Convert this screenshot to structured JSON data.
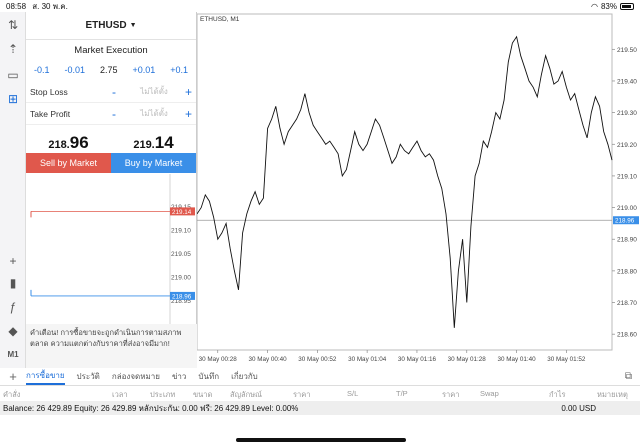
{
  "status": {
    "time": "08:58",
    "date": "ส. 30 พ.ค.",
    "battery": "83%"
  },
  "panel": {
    "symbol": "ETHUSD",
    "mode": "Market Execution",
    "steps": [
      "-0.1",
      "-0.01",
      "2.75",
      "+0.01",
      "+0.1"
    ],
    "stop_loss": {
      "label": "Stop Loss",
      "value": "ไม่ได้ตั้ง"
    },
    "take_profit": {
      "label": "Take Profit",
      "value": "ไม่ได้ตั้ง"
    },
    "bid": {
      "prefix": "218.",
      "big": "96"
    },
    "ask": {
      "prefix": "219.",
      "big": "14"
    },
    "sell_label": "Sell by Market",
    "buy_label": "Buy by Market",
    "warning": "คำเตือน! การซื้อขายจะถูกดำเนินการตามสภาพตลาด ความแตกต่างกับราคาที่ส่งอาจมีมาก!"
  },
  "depth": {
    "ticks": [
      219.15,
      219.1,
      219.05,
      219.0,
      218.95
    ],
    "ask": 219.14,
    "bid": 218.96,
    "ask_label": "219.14",
    "bid_label": "218.96",
    "ask_color": "#e0584c",
    "bid_color": "#3a8fe8"
  },
  "chart_data": {
    "type": "line",
    "title": "ETHUSD, M1",
    "ylim": [
      218.55,
      219.58
    ],
    "y_ticks": [
      219.5,
      219.4,
      219.3,
      219.2,
      219.1,
      219.0,
      218.9,
      218.8,
      218.7,
      218.6
    ],
    "x_tick_labels": [
      "30 May 00:28",
      "30 May 00:40",
      "30 May 00:52",
      "30 May 01:04",
      "30 May 01:16",
      "30 May 01:28",
      "30 May 01:40",
      "30 May 01:52"
    ],
    "x_tick_positions": [
      5,
      17,
      29,
      41,
      53,
      65,
      77,
      89
    ],
    "current_price": 218.96,
    "current_price_label": "218.96",
    "series": [
      {
        "x": [
          0,
          1,
          2,
          3,
          4,
          5,
          6,
          7,
          8,
          9,
          10,
          11,
          12,
          13,
          14,
          15,
          16,
          17,
          18,
          19,
          20,
          21,
          22,
          23,
          24,
          25,
          26,
          27,
          28,
          29,
          30,
          31,
          32,
          33,
          34,
          35,
          36,
          37,
          38,
          39,
          40,
          41,
          42,
          43,
          44,
          45,
          46,
          47,
          48,
          49,
          50,
          51,
          52,
          53,
          54,
          55,
          56,
          57,
          58,
          59,
          60,
          61,
          62,
          63,
          64,
          65,
          66,
          67,
          68,
          69,
          70,
          71,
          72,
          73,
          74,
          75,
          76,
          77,
          78,
          79,
          80,
          81,
          82,
          83,
          84,
          85,
          86,
          87,
          88,
          89,
          90,
          91,
          92,
          93,
          94,
          95,
          96,
          97,
          98,
          99,
          100
        ],
        "values": [
          218.98,
          219.0,
          219.04,
          219.02,
          218.97,
          218.9,
          218.92,
          218.95,
          218.87,
          218.8,
          218.74,
          218.92,
          218.98,
          219.02,
          219.05,
          219.01,
          219.03,
          219.25,
          219.28,
          219.32,
          219.25,
          219.2,
          219.24,
          219.26,
          219.28,
          219.31,
          219.36,
          219.3,
          219.26,
          219.24,
          219.22,
          219.2,
          219.21,
          219.19,
          219.17,
          219.1,
          219.12,
          219.18,
          219.24,
          219.2,
          219.18,
          219.2,
          219.24,
          219.28,
          219.26,
          219.22,
          219.18,
          219.14,
          219.16,
          219.2,
          219.18,
          219.17,
          219.19,
          219.21,
          219.18,
          219.16,
          219.17,
          219.15,
          219.1,
          219.06,
          218.98,
          218.84,
          218.62,
          218.8,
          218.9,
          218.7,
          218.94,
          219.1,
          219.14,
          219.21,
          219.19,
          219.24,
          219.3,
          219.28,
          219.34,
          219.46,
          219.52,
          219.54,
          219.48,
          219.44,
          219.4,
          219.38,
          219.35,
          219.42,
          219.48,
          219.44,
          219.39,
          219.4,
          219.43,
          219.38,
          219.34,
          219.36,
          219.31,
          219.26,
          219.22,
          219.3,
          219.35,
          219.32,
          219.24,
          219.2,
          219.15
        ]
      }
    ]
  },
  "tabs": {
    "add": "+",
    "items": [
      {
        "label": "การซื้อขาย",
        "active": true
      },
      {
        "label": "ประวัติ",
        "active": false
      },
      {
        "label": "กล่องจดหมาย",
        "active": false
      },
      {
        "label": "ข่าว",
        "active": false
      },
      {
        "label": "บันทึก",
        "active": false
      },
      {
        "label": "เกี่ยวกับ",
        "active": false
      }
    ]
  },
  "columns": [
    "คำสั่ง",
    "เวลา",
    "ประเภท",
    "ขนาด",
    "สัญลักษณ์",
    "ราคา",
    "S/L",
    "T/P",
    "ราคา",
    "Swap",
    "กำไร",
    "หมายเหตุ"
  ],
  "balance": {
    "text": "Balance: 26 429.89  Equity: 26 429.89  หลักประกัน: 0.00  ฟรี: 26 429.89  Level: 0.00%",
    "profit": "0.00  USD"
  }
}
